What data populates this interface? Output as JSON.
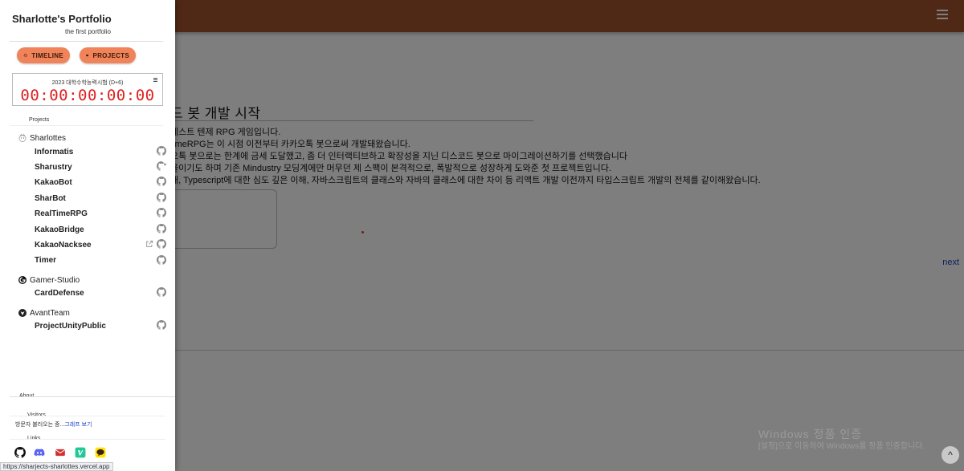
{
  "background": {
    "heading": "드 봇 개발 시작",
    "lines": [
      "테스트 텐제 RPG 게임입니다.",
      "timeRPG는 이 시점 이전부터 카카오톡 봇으로써 개발돼왔습니다.",
      "오톡 봇으로는 한계에 금세 도달했고, 좀 더 인터랙티브하고 확장성을 지닌 디스코드 봇으로 마이그레이션하기를 선택했습니다",
      "을이기도 하며 기존 Mindustry 모딩계에만 머무던 제 스팩이 본격적으로, 폭발적으로 성장하게 도와준 첫 프로젝트입니다.",
      "해, Typescript에 대한 심도 깊은 이해, 자바스크립트의 클래스와 자바의 클래스에 대한 차이 등 리액트 개발 이전까지 타입스크립트 개발의 전체를 같이해왔습니다."
    ],
    "next_label": "next",
    "windows_title": "Windows 정품 인증",
    "windows_subtitle": "[설정]으로 이동하여 Windows를 정품 인증합니다.",
    "scroll_top_glyph": "^",
    "appbar_color": "#a0522d"
  },
  "drawer": {
    "title": "Sharlotte's Portfolio",
    "subtitle": "the first portfolio",
    "buttons": {
      "timeline": "TIMELINE",
      "projects": "PROJECTS"
    },
    "countdown": {
      "label": "2023 대학수학능력시험 (D+6)",
      "time": "00:00:00:00:00"
    },
    "projects_label": "Projects",
    "groups": [
      {
        "name": "Sharlottes",
        "icon": "sharlottes-icon",
        "projects": [
          {
            "name": "Informatis",
            "github": true
          },
          {
            "name": "Sharustry",
            "github": true
          },
          {
            "name": "KakaoBot",
            "github": true
          },
          {
            "name": "SharBot",
            "github": true
          },
          {
            "name": "RealTimeRPG",
            "github": true
          },
          {
            "name": "KakaoBridge",
            "github": true
          },
          {
            "name": "KakaoNacksee",
            "github": true,
            "external": true
          },
          {
            "name": "Timer",
            "github": true
          }
        ]
      },
      {
        "name": "Gamer-Studio",
        "icon": "gamer-studio-icon",
        "projects": [
          {
            "name": "CardDefense",
            "github": true
          }
        ]
      },
      {
        "name": "AvantTeam",
        "icon": "avantteam-icon",
        "projects": [
          {
            "name": "ProjectUnityPublic",
            "github": true
          }
        ]
      }
    ],
    "about_label": "About",
    "visitors_label": "Visitors",
    "visitors_text": "방문자 불러오는 중...",
    "visitors_link": "그래프 보기",
    "links_label": "Links",
    "links": [
      "github-icon",
      "discord-icon",
      "mail-icon",
      "velog-icon",
      "kakaotalk-icon"
    ],
    "accent_color": "#f0835a"
  },
  "status_url": "https://sharjects-sharlottes.vercel.app"
}
